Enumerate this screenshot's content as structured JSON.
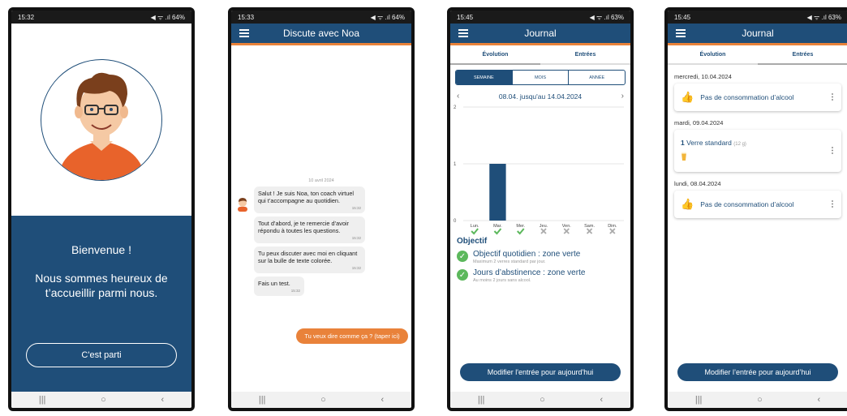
{
  "screen1": {
    "status": {
      "time": "15:32",
      "icons": "◀ ᯤ .ıl 64%"
    },
    "welcome_title": "Bienvenue !",
    "welcome_text": "Nous sommes heureux de t’accueillir parmi nous.",
    "start_button": "C'est parti"
  },
  "screen2": {
    "status": {
      "time": "15:33",
      "icons": "◀ ᯤ .ıl 64%"
    },
    "title": "Discute avec Noa",
    "date": "10 avril 2024",
    "messages": [
      {
        "text": "Salut ! Je suis Noa, ton coach virtuel qui t’accompagne au quotidien.",
        "time": "15:32"
      },
      {
        "text": "Tout d’abord, je te remercie d’avoir répondu à toutes les questions.",
        "time": "15:32"
      },
      {
        "text": "Tu peux discuter avec moi en cliquant sur la bulle de texte colorée.",
        "time": "15:32"
      },
      {
        "text": "Fais un test.",
        "time": "15:32"
      }
    ],
    "reply": "Tu veux dire comme ça ? (taper ici)"
  },
  "screen3": {
    "status": {
      "time": "15:45",
      "icons": "◀ ᯤ .ıl 63%"
    },
    "title": "Journal",
    "tabs": [
      "Évolution",
      "Entrées"
    ],
    "segments": [
      "SEMAINE",
      "MOIS",
      "ANNÉE"
    ],
    "range": "08.04. jusqu'au 14.04.2024",
    "objective_title": "Objectif",
    "objectives": [
      {
        "title": "Objectif quotidien : zone verte",
        "sub": "Maximum 2 verres standard par jour."
      },
      {
        "title": "Jours d’abstinence : zone verte",
        "sub": "Au moins 2 jours sans alcool."
      }
    ],
    "button": "Modifier l'entrée pour aujourd'hui"
  },
  "chart_data": {
    "type": "bar",
    "categories": [
      "Lun.",
      "Mar.",
      "Mer.",
      "Jeu.",
      "Ven.",
      "Sam.",
      "Dim."
    ],
    "values": [
      0,
      1,
      0,
      0,
      0,
      0,
      0
    ],
    "status": [
      "check",
      "check",
      "check",
      "cross",
      "cross",
      "cross",
      "cross"
    ],
    "yticks": [
      "0",
      "1",
      "2"
    ],
    "ylim": [
      0,
      2
    ],
    "grid": true,
    "bar_color": "#1f4e79"
  },
  "screen4": {
    "status": {
      "time": "15:45",
      "icons": "◀ ᯤ .ıl 63%"
    },
    "title": "Journal",
    "tabs": [
      "Évolution",
      "Entrées"
    ],
    "entries": [
      {
        "day": "mercredi, 10.04.2024",
        "label": "Pas de consommation d’alcool"
      },
      {
        "day": "mardi, 09.04.2024",
        "count": "1",
        "label": "Verre standard",
        "grams": "(12 g)"
      },
      {
        "day": "lundi, 08.04.2024",
        "label": "Pas de consommation d’alcool"
      }
    ],
    "button": "Modifier l’entrée pour aujourd’hui"
  },
  "nav": {
    "recent": "|||",
    "home": "○",
    "back": "‹"
  },
  "colors": {
    "primary": "#1f4e79",
    "accent": "#e9823a",
    "success": "#5cb85c"
  }
}
